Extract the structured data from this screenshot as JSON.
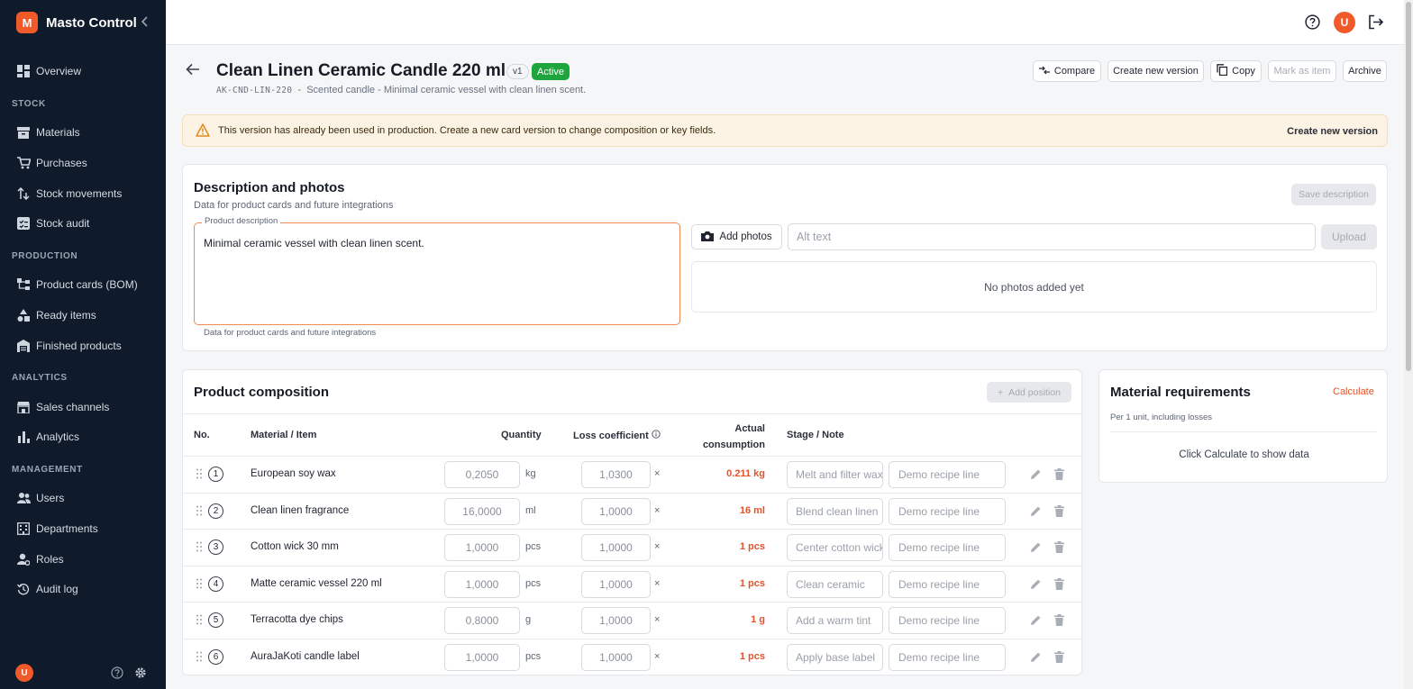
{
  "app": {
    "logo_letter": "M",
    "name": "Masto Control"
  },
  "sidebar": {
    "overview": "Overview",
    "sections": {
      "stock": "STOCK",
      "production": "PRODUCTION",
      "analytics": "ANALYTICS",
      "management": "MANAGEMENT"
    },
    "stock_items": [
      "Materials",
      "Purchases",
      "Stock movements",
      "Stock audit"
    ],
    "production_items": [
      "Product cards (BOM)",
      "Ready items",
      "Finished products"
    ],
    "analytics_items": [
      "Sales channels",
      "Analytics"
    ],
    "management_items": [
      "Users",
      "Departments",
      "Roles",
      "Audit log"
    ],
    "user_initial": "U"
  },
  "topbar": {
    "user_initial": "U"
  },
  "header": {
    "title": "Clean Linen Ceramic Candle 220 ml",
    "version": "v1",
    "status": "Active",
    "sku": "AK-CND-LIN-220",
    "separator": "-",
    "subtitle": "Scented candle - Minimal ceramic vessel with clean linen scent.",
    "buttons": {
      "compare": "Compare",
      "new_version": "Create new version",
      "copy": "Copy",
      "mark_as_item": "Mark as item",
      "archive": "Archive"
    }
  },
  "warning": {
    "text": "This version has already been used in production. Create a new card version to change composition or key fields.",
    "action": "Create new version"
  },
  "description_card": {
    "title": "Description and photos",
    "subtitle": "Data for product cards and future integrations",
    "save_button": "Save description",
    "field_label": "Product description",
    "field_value": "Minimal ceramic vessel with clean linen scent.",
    "field_hint": "Data for product cards and future integrations",
    "add_photos": "Add photos",
    "alt_text_placeholder": "Alt text",
    "upload": "Upload",
    "no_photos": "No photos added yet"
  },
  "composition": {
    "title": "Product composition",
    "add_position": "Add position",
    "columns": {
      "no": "No.",
      "material": "Material / Item",
      "quantity": "Quantity",
      "loss": "Loss coefficient",
      "actual_1": "Actual",
      "actual_2": "consumption",
      "stage": "Stage / Note"
    },
    "rows": [
      {
        "no": "1",
        "material": "European soy wax",
        "qty": "0,2050",
        "unit": "kg",
        "loss": "1,0300",
        "times": "×",
        "actual": "0.211 kg",
        "stage": "Melt and filter wax",
        "note": "Demo recipe line"
      },
      {
        "no": "2",
        "material": "Clean linen fragrance",
        "qty": "16,0000",
        "unit": "ml",
        "loss": "1,0000",
        "times": "×",
        "actual": "16 ml",
        "stage": "Blend clean linen",
        "note": "Demo recipe line"
      },
      {
        "no": "3",
        "material": "Cotton wick 30 mm",
        "qty": "1,0000",
        "unit": "pcs",
        "loss": "1,0000",
        "times": "×",
        "actual": "1 pcs",
        "stage": "Center cotton wick",
        "note": "Demo recipe line"
      },
      {
        "no": "4",
        "material": "Matte ceramic vessel 220 ml",
        "qty": "1,0000",
        "unit": "pcs",
        "loss": "1,0000",
        "times": "×",
        "actual": "1 pcs",
        "stage": "Clean ceramic",
        "note": "Demo recipe line"
      },
      {
        "no": "5",
        "material": "Terracotta dye chips",
        "qty": "0,8000",
        "unit": "g",
        "loss": "1,0000",
        "times": "×",
        "actual": "1 g",
        "stage": "Add a warm tint",
        "note": "Demo recipe line"
      },
      {
        "no": "6",
        "material": "AuraJaKoti candle label",
        "qty": "1,0000",
        "unit": "pcs",
        "loss": "1,0000",
        "times": "×",
        "actual": "1 pcs",
        "stage": "Apply base label",
        "note": "Demo recipe line"
      }
    ]
  },
  "requirements": {
    "title": "Material requirements",
    "calculate": "Calculate",
    "subtitle": "Per 1 unit, including losses",
    "empty": "Click Calculate to show data"
  },
  "colors": {
    "sidebar_bg": "#0f1a2a",
    "accent": "#f0592a",
    "active_green": "#1fa53e",
    "warning_bg": "#fdf3e4"
  }
}
